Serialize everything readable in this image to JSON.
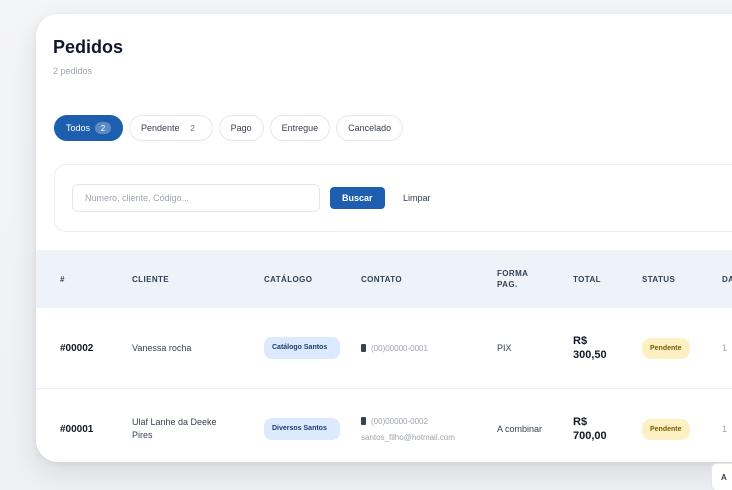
{
  "page": {
    "title": "Pedidos",
    "subtitle": "2 pedidos"
  },
  "tabs": [
    {
      "label": "Todos",
      "count": "2",
      "active": true
    },
    {
      "label": "Pendente",
      "count": "2",
      "active": false
    },
    {
      "label": "Pago",
      "count": "",
      "active": false
    },
    {
      "label": "Entregue",
      "count": "",
      "active": false
    },
    {
      "label": "Cancelado",
      "count": "",
      "active": false
    }
  ],
  "filters": {
    "search_placeholder": "Número, cliente, Código...",
    "search_label": "Buscar",
    "clear_label": "Limpar"
  },
  "table": {
    "headers": {
      "id": "#",
      "cliente": "CLIENTE",
      "catalogo": "CATÁLOGO",
      "contato": "CONTATO",
      "forma_pag": "FORMA PAG.",
      "total": "TOTAL",
      "status": "STATUS",
      "next": "DA"
    },
    "rows": [
      {
        "id": "#00002",
        "cliente": "Vanessa rocha",
        "catalogo": "Catálogo Santos",
        "phone": "(00)00000-0001",
        "email": "",
        "forma_pag": "PIX",
        "total": "R$ 300,50",
        "status": "Pendente",
        "next": "1"
      },
      {
        "id": "#00001",
        "cliente": "Ulaf Lanhe da Deeke Pires",
        "catalogo": "Diversos Santos",
        "phone": "(00)00000-0002",
        "email": "santos_filho@hotmail.com",
        "forma_pag": "A combinar",
        "total": "R$ 700,00",
        "status": "Pendente",
        "next": "1"
      }
    ]
  },
  "pagination": {
    "button_label": "A"
  },
  "colors": {
    "primary": "#1d5fae",
    "chip_bg": "#dbeafe",
    "status_pending_bg": "#fdf1c4",
    "header_bg": "#eef3fa"
  }
}
